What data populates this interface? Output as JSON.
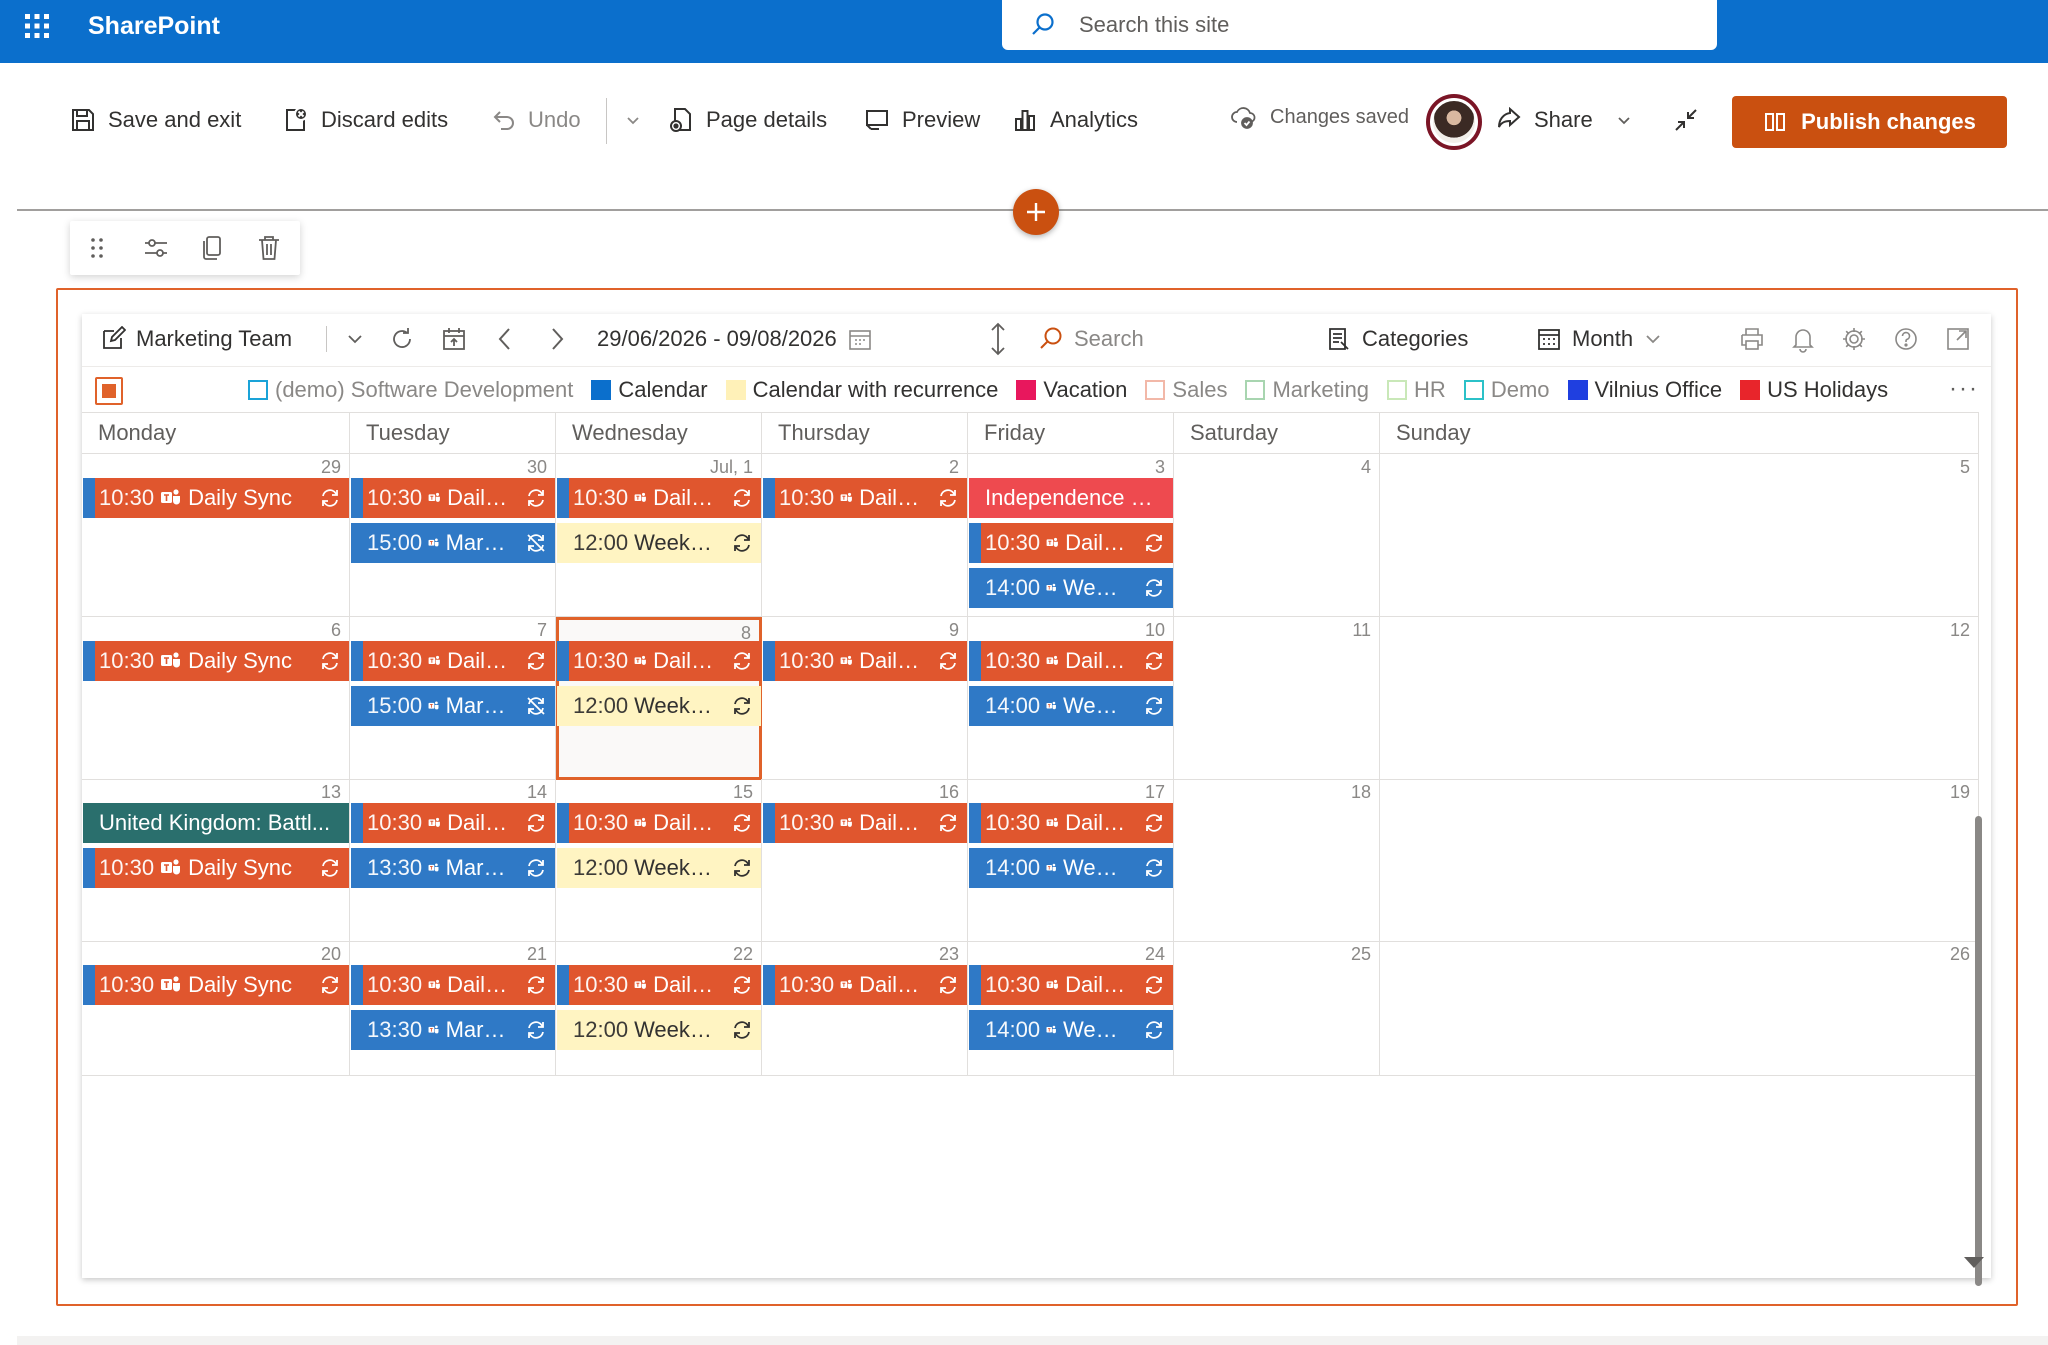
{
  "suite": {
    "app_name": "SharePoint",
    "search_placeholder": "Search this site"
  },
  "commands": {
    "save_exit": "Save and exit",
    "discard": "Discard edits",
    "undo": "Undo",
    "page_details": "Page details",
    "preview": "Preview",
    "analytics": "Analytics",
    "status": "Changes saved",
    "share": "Share",
    "publish": "Publish changes"
  },
  "calendar": {
    "name": "Marketing Team",
    "range": "29/06/2026 - 09/08/2026",
    "search_placeholder": "Search",
    "categories": "Categories",
    "view": "Month",
    "legend": [
      {
        "label": "(demo) Software Development",
        "color": "#1aa3d8",
        "hollow": true,
        "dim": true
      },
      {
        "label": "Calendar",
        "color": "#0b6fcc",
        "hollow": false,
        "dim": false
      },
      {
        "label": "Calendar with recurrence",
        "color": "#fff1b8",
        "hollow": false,
        "dim": false
      },
      {
        "label": "Vacation",
        "color": "#e8175d",
        "hollow": false,
        "dim": false
      },
      {
        "label": "Sales",
        "color": "#f2b8a8",
        "hollow": true,
        "dim": true
      },
      {
        "label": "Marketing",
        "color": "#a8d5b0",
        "hollow": true,
        "dim": true
      },
      {
        "label": "HR",
        "color": "#c9e8b8",
        "hollow": true,
        "dim": true
      },
      {
        "label": "Demo",
        "color": "#2bc1c8",
        "hollow": true,
        "dim": true
      },
      {
        "label": "Vilnius Office",
        "color": "#1f3fe0",
        "hollow": false,
        "dim": false
      },
      {
        "label": "US Holidays",
        "color": "#e8252b",
        "hollow": false,
        "dim": false
      }
    ],
    "weekdays": [
      "Monday",
      "Tuesday",
      "Wednesday",
      "Thursday",
      "Friday",
      "Saturday",
      "Sunday"
    ],
    "weeks": [
      {
        "days": [
          {
            "num": "29",
            "events": [
              {
                "text": "10:30",
                "title": "Daily Sync",
                "kind": "orange",
                "teams": true,
                "rec": "rec"
              }
            ]
          },
          {
            "num": "30",
            "events": [
              {
                "text": "10:30",
                "title": "Daily Sync",
                "kind": "orange",
                "teams": true,
                "rec": "rec"
              },
              {
                "text": "15:00",
                "title": "Marketing ...",
                "kind": "blue",
                "teams": true,
                "rec": "recx"
              }
            ]
          },
          {
            "num": "Jul, 1",
            "events": [
              {
                "text": "10:30",
                "title": "Daily Sync",
                "kind": "orange",
                "teams": true,
                "rec": "rec"
              },
              {
                "text": "12:00",
                "title": "Weekly sync",
                "kind": "yellow",
                "teams": false,
                "rec": "rec"
              }
            ]
          },
          {
            "num": "2",
            "events": [
              {
                "text": "10:30",
                "title": "Daily Sync",
                "kind": "orange",
                "teams": true,
                "rec": "rec"
              }
            ]
          },
          {
            "num": "3",
            "events": [
              {
                "text": "",
                "title": "Independence Day",
                "kind": "red",
                "teams": false,
                "rec": ""
              },
              {
                "text": "10:30",
                "title": "Daily Sync",
                "kind": "orange",
                "teams": true,
                "rec": "rec"
              },
              {
                "text": "14:00",
                "title": "Weekly We...",
                "kind": "blue",
                "teams": true,
                "rec": "rec"
              }
            ]
          },
          {
            "num": "4",
            "events": []
          },
          {
            "num": "5",
            "events": []
          }
        ]
      },
      {
        "days": [
          {
            "num": "6",
            "events": [
              {
                "text": "10:30",
                "title": "Daily Sync",
                "kind": "orange",
                "teams": true,
                "rec": "rec"
              }
            ]
          },
          {
            "num": "7",
            "events": [
              {
                "text": "10:30",
                "title": "Daily Sync",
                "kind": "orange",
                "teams": true,
                "rec": "rec"
              },
              {
                "text": "15:00",
                "title": "Marketing ...",
                "kind": "blue",
                "teams": true,
                "rec": "recx"
              }
            ]
          },
          {
            "num": "8",
            "today": true,
            "events": [
              {
                "text": "10:30",
                "title": "Daily Sync",
                "kind": "orange",
                "teams": true,
                "rec": "rec"
              },
              {
                "text": "12:00",
                "title": "Weekly sync",
                "kind": "yellow",
                "teams": false,
                "rec": "rec"
              }
            ]
          },
          {
            "num": "9",
            "events": [
              {
                "text": "10:30",
                "title": "Daily Sync",
                "kind": "orange",
                "teams": true,
                "rec": "rec"
              }
            ]
          },
          {
            "num": "10",
            "events": [
              {
                "text": "10:30",
                "title": "Daily Sync",
                "kind": "orange",
                "teams": true,
                "rec": "rec"
              },
              {
                "text": "14:00",
                "title": "Weekly We...",
                "kind": "blue",
                "teams": true,
                "rec": "rec"
              }
            ]
          },
          {
            "num": "11",
            "events": []
          },
          {
            "num": "12",
            "events": []
          }
        ]
      },
      {
        "days": [
          {
            "num": "13",
            "events": [
              {
                "text": "",
                "title": "United Kingdom: Battl...",
                "kind": "teal",
                "teams": false,
                "rec": ""
              },
              {
                "text": "10:30",
                "title": "Daily Sync",
                "kind": "orange",
                "teams": true,
                "rec": "rec"
              }
            ]
          },
          {
            "num": "14",
            "events": [
              {
                "text": "10:30",
                "title": "Daily Sync",
                "kind": "orange",
                "teams": true,
                "rec": "rec"
              },
              {
                "text": "13:30",
                "title": "Marketing ...",
                "kind": "blue",
                "teams": true,
                "rec": "rec"
              }
            ]
          },
          {
            "num": "15",
            "events": [
              {
                "text": "10:30",
                "title": "Daily Sync",
                "kind": "orange",
                "teams": true,
                "rec": "rec"
              },
              {
                "text": "12:00",
                "title": "Weekly sync",
                "kind": "yellow",
                "teams": false,
                "rec": "rec"
              }
            ]
          },
          {
            "num": "16",
            "events": [
              {
                "text": "10:30",
                "title": "Daily Sync",
                "kind": "orange",
                "teams": true,
                "rec": "rec"
              }
            ]
          },
          {
            "num": "17",
            "events": [
              {
                "text": "10:30",
                "title": "Daily Sync",
                "kind": "orange",
                "teams": true,
                "rec": "rec"
              },
              {
                "text": "14:00",
                "title": "Weekly We...",
                "kind": "blue",
                "teams": true,
                "rec": "rec"
              }
            ]
          },
          {
            "num": "18",
            "events": []
          },
          {
            "num": "19",
            "events": []
          }
        ]
      },
      {
        "days": [
          {
            "num": "20",
            "events": [
              {
                "text": "10:30",
                "title": "Daily Sync",
                "kind": "orange",
                "teams": true,
                "rec": "rec"
              }
            ]
          },
          {
            "num": "21",
            "events": [
              {
                "text": "10:30",
                "title": "Daily Sync",
                "kind": "orange",
                "teams": true,
                "rec": "rec"
              },
              {
                "text": "13:30",
                "title": "Marketing ...",
                "kind": "blue",
                "teams": true,
                "rec": "rec"
              }
            ]
          },
          {
            "num": "22",
            "events": [
              {
                "text": "10:30",
                "title": "Daily Sync",
                "kind": "orange",
                "teams": true,
                "rec": "rec"
              },
              {
                "text": "12:00",
                "title": "Weekly sync",
                "kind": "yellow",
                "teams": false,
                "rec": "rec"
              }
            ]
          },
          {
            "num": "23",
            "events": [
              {
                "text": "10:30",
                "title": "Daily Sync",
                "kind": "orange",
                "teams": true,
                "rec": "rec"
              }
            ]
          },
          {
            "num": "24",
            "events": [
              {
                "text": "10:30",
                "title": "Daily Sync",
                "kind": "orange",
                "teams": true,
                "rec": "rec"
              },
              {
                "text": "14:00",
                "title": "Weekly We...",
                "kind": "blue",
                "teams": true,
                "rec": "rec"
              }
            ]
          },
          {
            "num": "25",
            "events": []
          },
          {
            "num": "26",
            "events": []
          }
        ]
      }
    ]
  },
  "colors": {
    "suite_blue": "#0b6fcc",
    "accent_orange": "#ca5010",
    "event_orange": "#e0562e",
    "event_blue": "#2f79c6",
    "event_yellow": "#fff4c2"
  }
}
